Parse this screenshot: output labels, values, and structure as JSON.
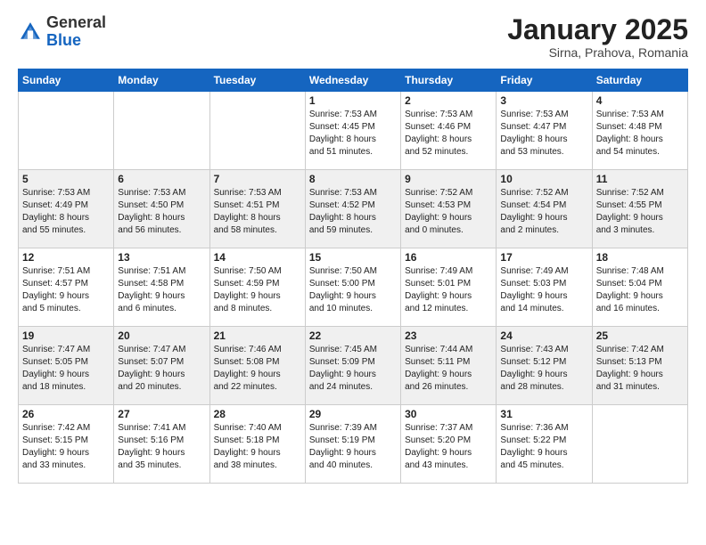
{
  "header": {
    "logo_general": "General",
    "logo_blue": "Blue",
    "month": "January 2025",
    "location": "Sirna, Prahova, Romania"
  },
  "weekdays": [
    "Sunday",
    "Monday",
    "Tuesday",
    "Wednesday",
    "Thursday",
    "Friday",
    "Saturday"
  ],
  "weeks": [
    [
      {
        "day": "",
        "info": ""
      },
      {
        "day": "",
        "info": ""
      },
      {
        "day": "",
        "info": ""
      },
      {
        "day": "1",
        "info": "Sunrise: 7:53 AM\nSunset: 4:45 PM\nDaylight: 8 hours\nand 51 minutes."
      },
      {
        "day": "2",
        "info": "Sunrise: 7:53 AM\nSunset: 4:46 PM\nDaylight: 8 hours\nand 52 minutes."
      },
      {
        "day": "3",
        "info": "Sunrise: 7:53 AM\nSunset: 4:47 PM\nDaylight: 8 hours\nand 53 minutes."
      },
      {
        "day": "4",
        "info": "Sunrise: 7:53 AM\nSunset: 4:48 PM\nDaylight: 8 hours\nand 54 minutes."
      }
    ],
    [
      {
        "day": "5",
        "info": "Sunrise: 7:53 AM\nSunset: 4:49 PM\nDaylight: 8 hours\nand 55 minutes."
      },
      {
        "day": "6",
        "info": "Sunrise: 7:53 AM\nSunset: 4:50 PM\nDaylight: 8 hours\nand 56 minutes."
      },
      {
        "day": "7",
        "info": "Sunrise: 7:53 AM\nSunset: 4:51 PM\nDaylight: 8 hours\nand 58 minutes."
      },
      {
        "day": "8",
        "info": "Sunrise: 7:53 AM\nSunset: 4:52 PM\nDaylight: 8 hours\nand 59 minutes."
      },
      {
        "day": "9",
        "info": "Sunrise: 7:52 AM\nSunset: 4:53 PM\nDaylight: 9 hours\nand 0 minutes."
      },
      {
        "day": "10",
        "info": "Sunrise: 7:52 AM\nSunset: 4:54 PM\nDaylight: 9 hours\nand 2 minutes."
      },
      {
        "day": "11",
        "info": "Sunrise: 7:52 AM\nSunset: 4:55 PM\nDaylight: 9 hours\nand 3 minutes."
      }
    ],
    [
      {
        "day": "12",
        "info": "Sunrise: 7:51 AM\nSunset: 4:57 PM\nDaylight: 9 hours\nand 5 minutes."
      },
      {
        "day": "13",
        "info": "Sunrise: 7:51 AM\nSunset: 4:58 PM\nDaylight: 9 hours\nand 6 minutes."
      },
      {
        "day": "14",
        "info": "Sunrise: 7:50 AM\nSunset: 4:59 PM\nDaylight: 9 hours\nand 8 minutes."
      },
      {
        "day": "15",
        "info": "Sunrise: 7:50 AM\nSunset: 5:00 PM\nDaylight: 9 hours\nand 10 minutes."
      },
      {
        "day": "16",
        "info": "Sunrise: 7:49 AM\nSunset: 5:01 PM\nDaylight: 9 hours\nand 12 minutes."
      },
      {
        "day": "17",
        "info": "Sunrise: 7:49 AM\nSunset: 5:03 PM\nDaylight: 9 hours\nand 14 minutes."
      },
      {
        "day": "18",
        "info": "Sunrise: 7:48 AM\nSunset: 5:04 PM\nDaylight: 9 hours\nand 16 minutes."
      }
    ],
    [
      {
        "day": "19",
        "info": "Sunrise: 7:47 AM\nSunset: 5:05 PM\nDaylight: 9 hours\nand 18 minutes."
      },
      {
        "day": "20",
        "info": "Sunrise: 7:47 AM\nSunset: 5:07 PM\nDaylight: 9 hours\nand 20 minutes."
      },
      {
        "day": "21",
        "info": "Sunrise: 7:46 AM\nSunset: 5:08 PM\nDaylight: 9 hours\nand 22 minutes."
      },
      {
        "day": "22",
        "info": "Sunrise: 7:45 AM\nSunset: 5:09 PM\nDaylight: 9 hours\nand 24 minutes."
      },
      {
        "day": "23",
        "info": "Sunrise: 7:44 AM\nSunset: 5:11 PM\nDaylight: 9 hours\nand 26 minutes."
      },
      {
        "day": "24",
        "info": "Sunrise: 7:43 AM\nSunset: 5:12 PM\nDaylight: 9 hours\nand 28 minutes."
      },
      {
        "day": "25",
        "info": "Sunrise: 7:42 AM\nSunset: 5:13 PM\nDaylight: 9 hours\nand 31 minutes."
      }
    ],
    [
      {
        "day": "26",
        "info": "Sunrise: 7:42 AM\nSunset: 5:15 PM\nDaylight: 9 hours\nand 33 minutes."
      },
      {
        "day": "27",
        "info": "Sunrise: 7:41 AM\nSunset: 5:16 PM\nDaylight: 9 hours\nand 35 minutes."
      },
      {
        "day": "28",
        "info": "Sunrise: 7:40 AM\nSunset: 5:18 PM\nDaylight: 9 hours\nand 38 minutes."
      },
      {
        "day": "29",
        "info": "Sunrise: 7:39 AM\nSunset: 5:19 PM\nDaylight: 9 hours\nand 40 minutes."
      },
      {
        "day": "30",
        "info": "Sunrise: 7:37 AM\nSunset: 5:20 PM\nDaylight: 9 hours\nand 43 minutes."
      },
      {
        "day": "31",
        "info": "Sunrise: 7:36 AM\nSunset: 5:22 PM\nDaylight: 9 hours\nand 45 minutes."
      },
      {
        "day": "",
        "info": ""
      }
    ]
  ]
}
